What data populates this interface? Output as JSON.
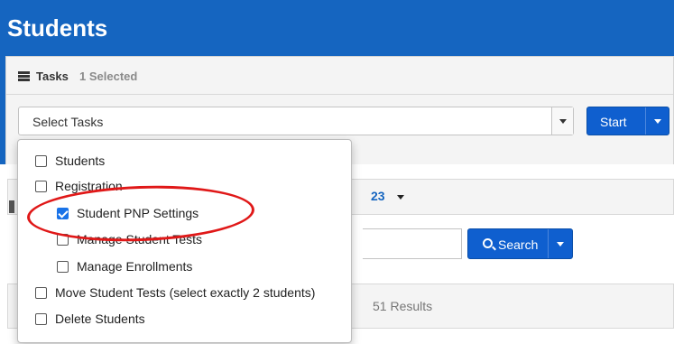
{
  "page": {
    "title": "Students"
  },
  "tasks": {
    "label": "Tasks",
    "selected_count": "1 Selected",
    "select_placeholder": "Select Tasks",
    "start_label": "Start"
  },
  "filter": {
    "link_fragment": "23"
  },
  "search": {
    "button_label": "Search"
  },
  "results": {
    "text": "51 Results"
  },
  "dropdown": {
    "options": [
      {
        "label": "Students",
        "checked": false,
        "indent": 0
      },
      {
        "label": "Registration",
        "checked": false,
        "indent": 0
      },
      {
        "label": "Student PNP Settings",
        "checked": true,
        "indent": 1
      },
      {
        "label": "Manage Student Tests",
        "checked": false,
        "indent": 1
      },
      {
        "label": "Manage Enrollments",
        "checked": false,
        "indent": 1
      },
      {
        "label": "Move Student Tests (select exactly 2 students)",
        "checked": false,
        "indent": 0
      },
      {
        "label": "Delete Students",
        "checked": false,
        "indent": 0
      }
    ]
  },
  "colors": {
    "header_blue": "#1565c0",
    "button_blue": "#0f5fcf",
    "highlight_red": "#e01818",
    "checkbox_blue": "#1a73e8"
  },
  "icons": {
    "tasks": "list-icon",
    "search": "search-icon",
    "caret": "chevron-down-icon"
  }
}
